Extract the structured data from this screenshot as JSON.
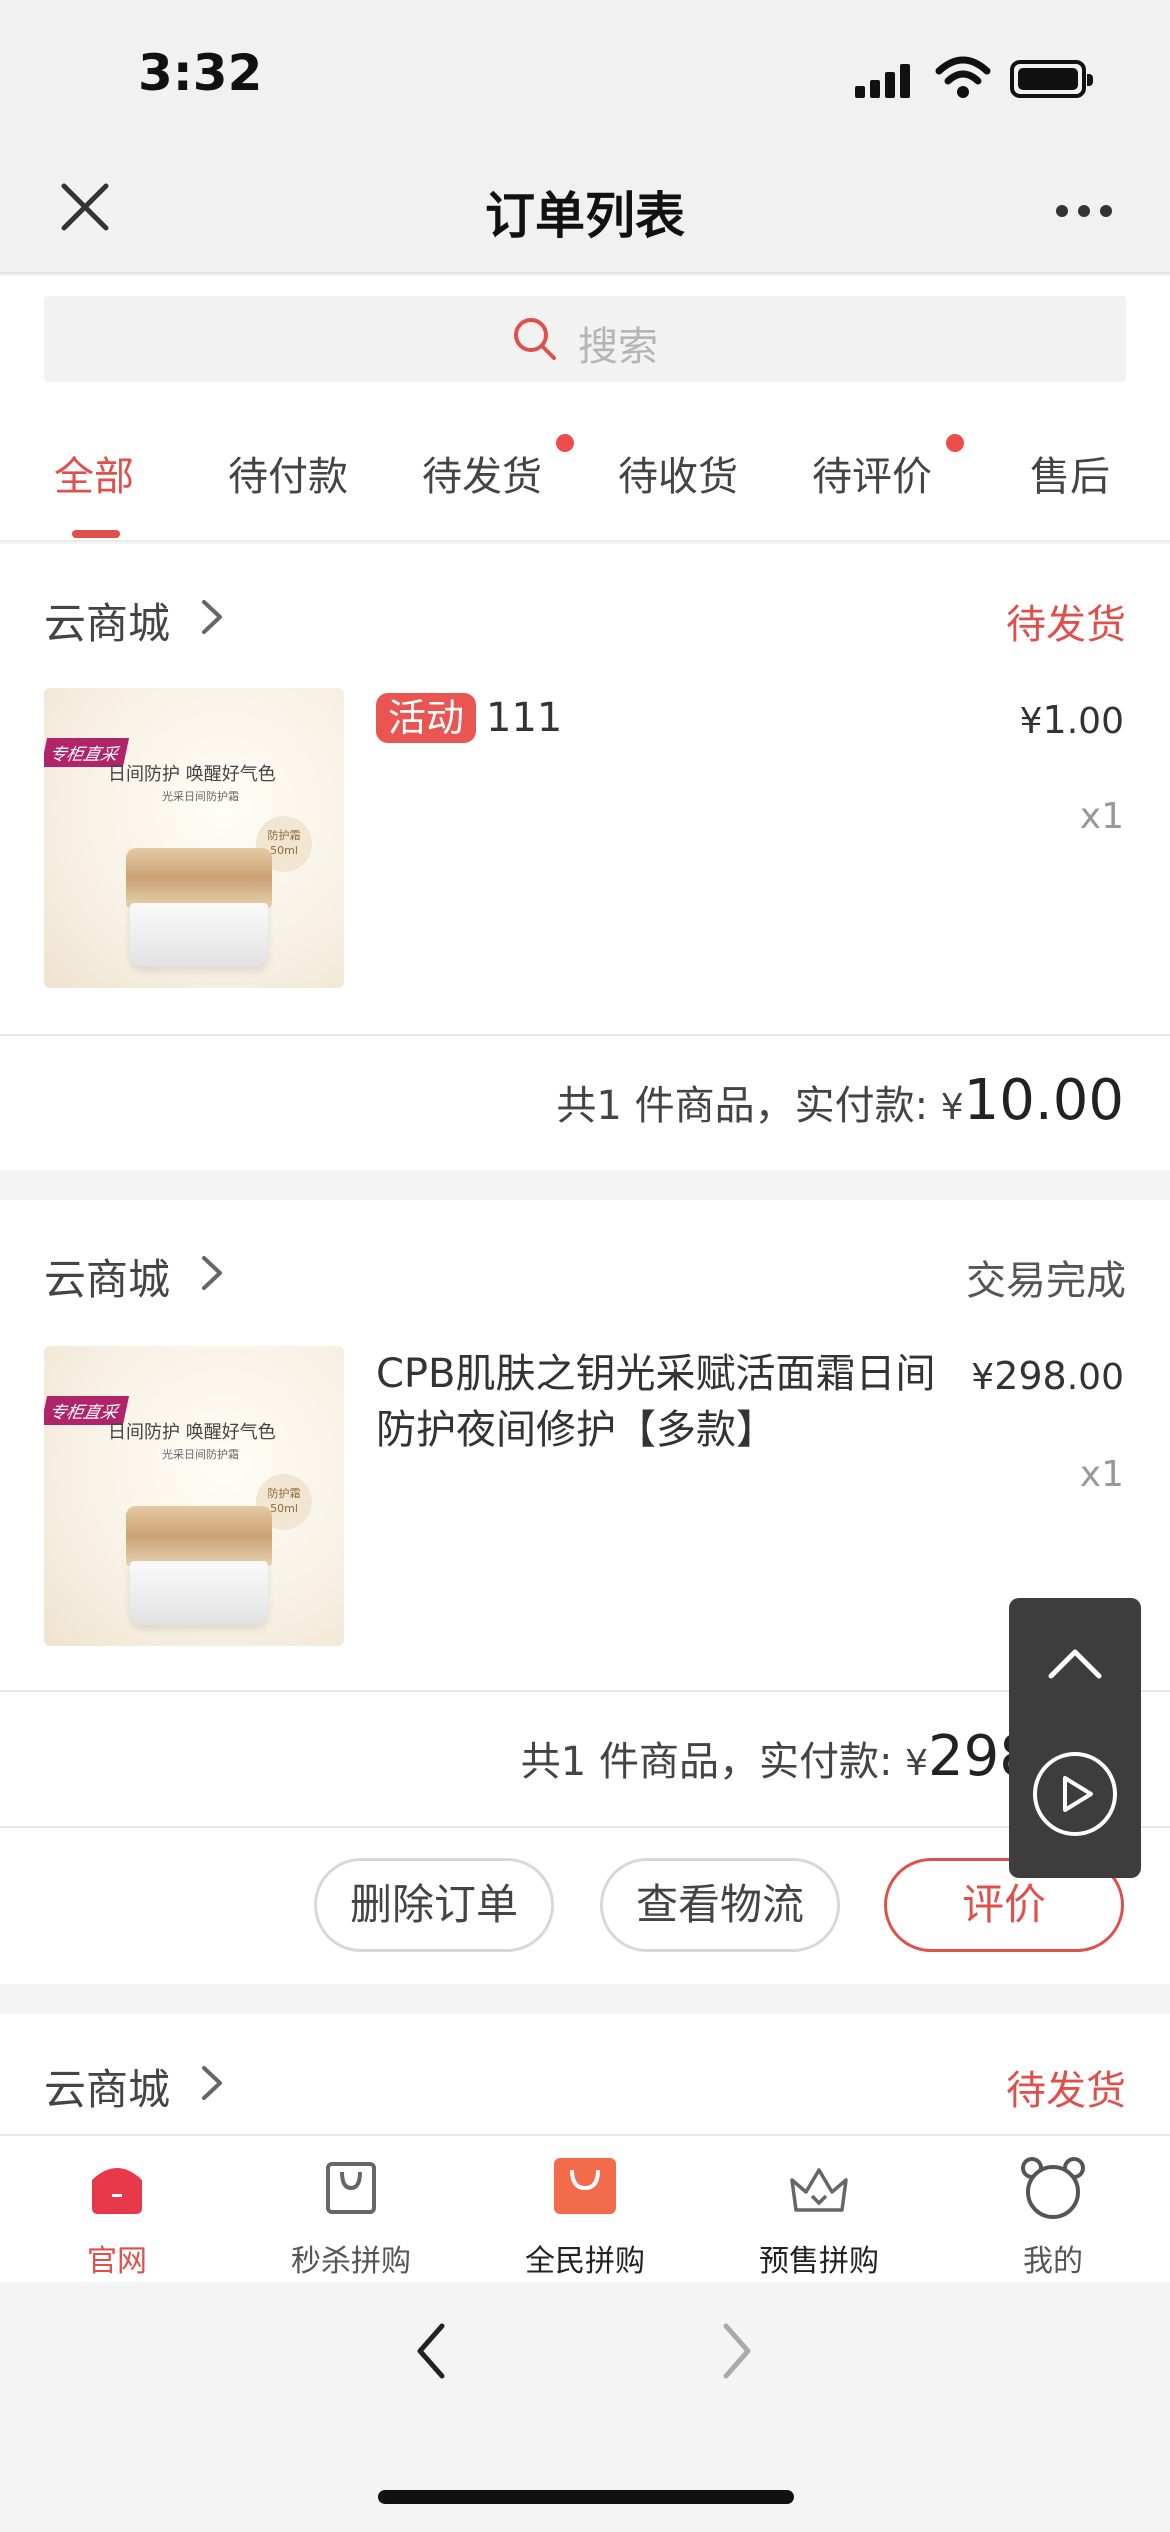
{
  "status_bar": {
    "time": "3:32"
  },
  "nav": {
    "title": "订单列表"
  },
  "search": {
    "placeholder": "搜索"
  },
  "tabs": [
    {
      "label": "全部",
      "active": true,
      "dot": false
    },
    {
      "label": "待付款",
      "active": false,
      "dot": false
    },
    {
      "label": "待发货",
      "active": false,
      "dot": true
    },
    {
      "label": "待收货",
      "active": false,
      "dot": false
    },
    {
      "label": "待评价",
      "active": false,
      "dot": true
    },
    {
      "label": "售后",
      "active": false,
      "dot": false
    }
  ],
  "orders": [
    {
      "shop": "云商城",
      "status": "待发货",
      "status_color": "#e0504a",
      "badge": "活动",
      "title": "111",
      "price_symbol": "¥",
      "price_int": "1",
      "price_dec": ".00",
      "qty": "x1",
      "summary": "共1 件商品，实付款: ",
      "currency": "¥",
      "total": "10.00"
    },
    {
      "shop": "云商城",
      "status": "交易完成",
      "status_color": "#555555",
      "title": "CPB肌肤之钥光采赋活面霜日间防护夜间修护【多款】",
      "price_symbol": "¥",
      "price_int": "298",
      "price_dec": ".00",
      "qty": "x1",
      "summary": "共1 件商品，实付款: ",
      "currency": "¥",
      "total": "298.00",
      "buttons": [
        "删除订单",
        "查看物流",
        "评价"
      ]
    },
    {
      "shop": "云商城",
      "status": "待发货",
      "status_color": "#e0504a"
    }
  ],
  "product_image": {
    "tag": "专柜直采",
    "headline": "日间防护 唤醒好气色",
    "subline": "光采日间防护霜",
    "size_top": "防护霜",
    "size": "50ml"
  },
  "tabbar": [
    {
      "label": "官网",
      "icon": "home-icon",
      "active": true
    },
    {
      "label": "秒杀拼购",
      "icon": "shopping-bag-outline-icon",
      "active": false
    },
    {
      "label": "全民拼购",
      "icon": "shopping-bag-filled-icon",
      "active": false
    },
    {
      "label": "预售拼购",
      "icon": "crown-icon",
      "active": false
    },
    {
      "label": "我的",
      "icon": "bear-icon",
      "active": false
    }
  ],
  "colors": {
    "accent": "#e0504a",
    "orange": "#f26b4a"
  }
}
